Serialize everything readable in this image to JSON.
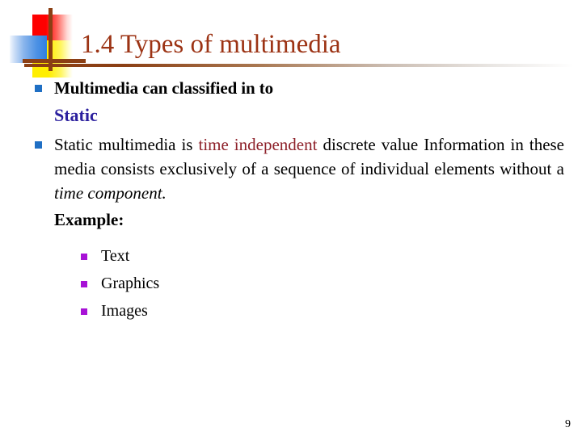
{
  "slide": {
    "title": "1.4 Types of multimedia",
    "page_number": "9"
  },
  "logo": {
    "red_square": "red-square",
    "yellow_square": "yellow-square",
    "blue_square": "blue-square",
    "vertical_bar": "vertical-bar",
    "horizontal_bar": "horizontal-bar",
    "colors": {
      "red": "#fe0000",
      "yellow": "#ffee00",
      "blue": "#2f7fe0",
      "bar_brown": "#8b3f14"
    }
  },
  "colors": {
    "title_brown": "#9c3314",
    "static_blue": "#2b1f9e",
    "highlight_red": "#8d2029",
    "bullet_level1": "#1f6fc4",
    "bullet_level2": "#a712d6",
    "body_black": "#000000"
  },
  "body": {
    "intro": "Multimedia can classified in to",
    "static_heading": "Static",
    "paragraph": {
      "part1": "Static multimedia is ",
      "highlight": "time independent",
      "part2": " discrete value Information in these media consists exclusively of a sequence of individual elements without a ",
      "italic_tail": "time component."
    },
    "example_label": "Example:",
    "examples": [
      {
        "label": "Text"
      },
      {
        "label": "Graphics"
      },
      {
        "label": "Images"
      }
    ]
  }
}
